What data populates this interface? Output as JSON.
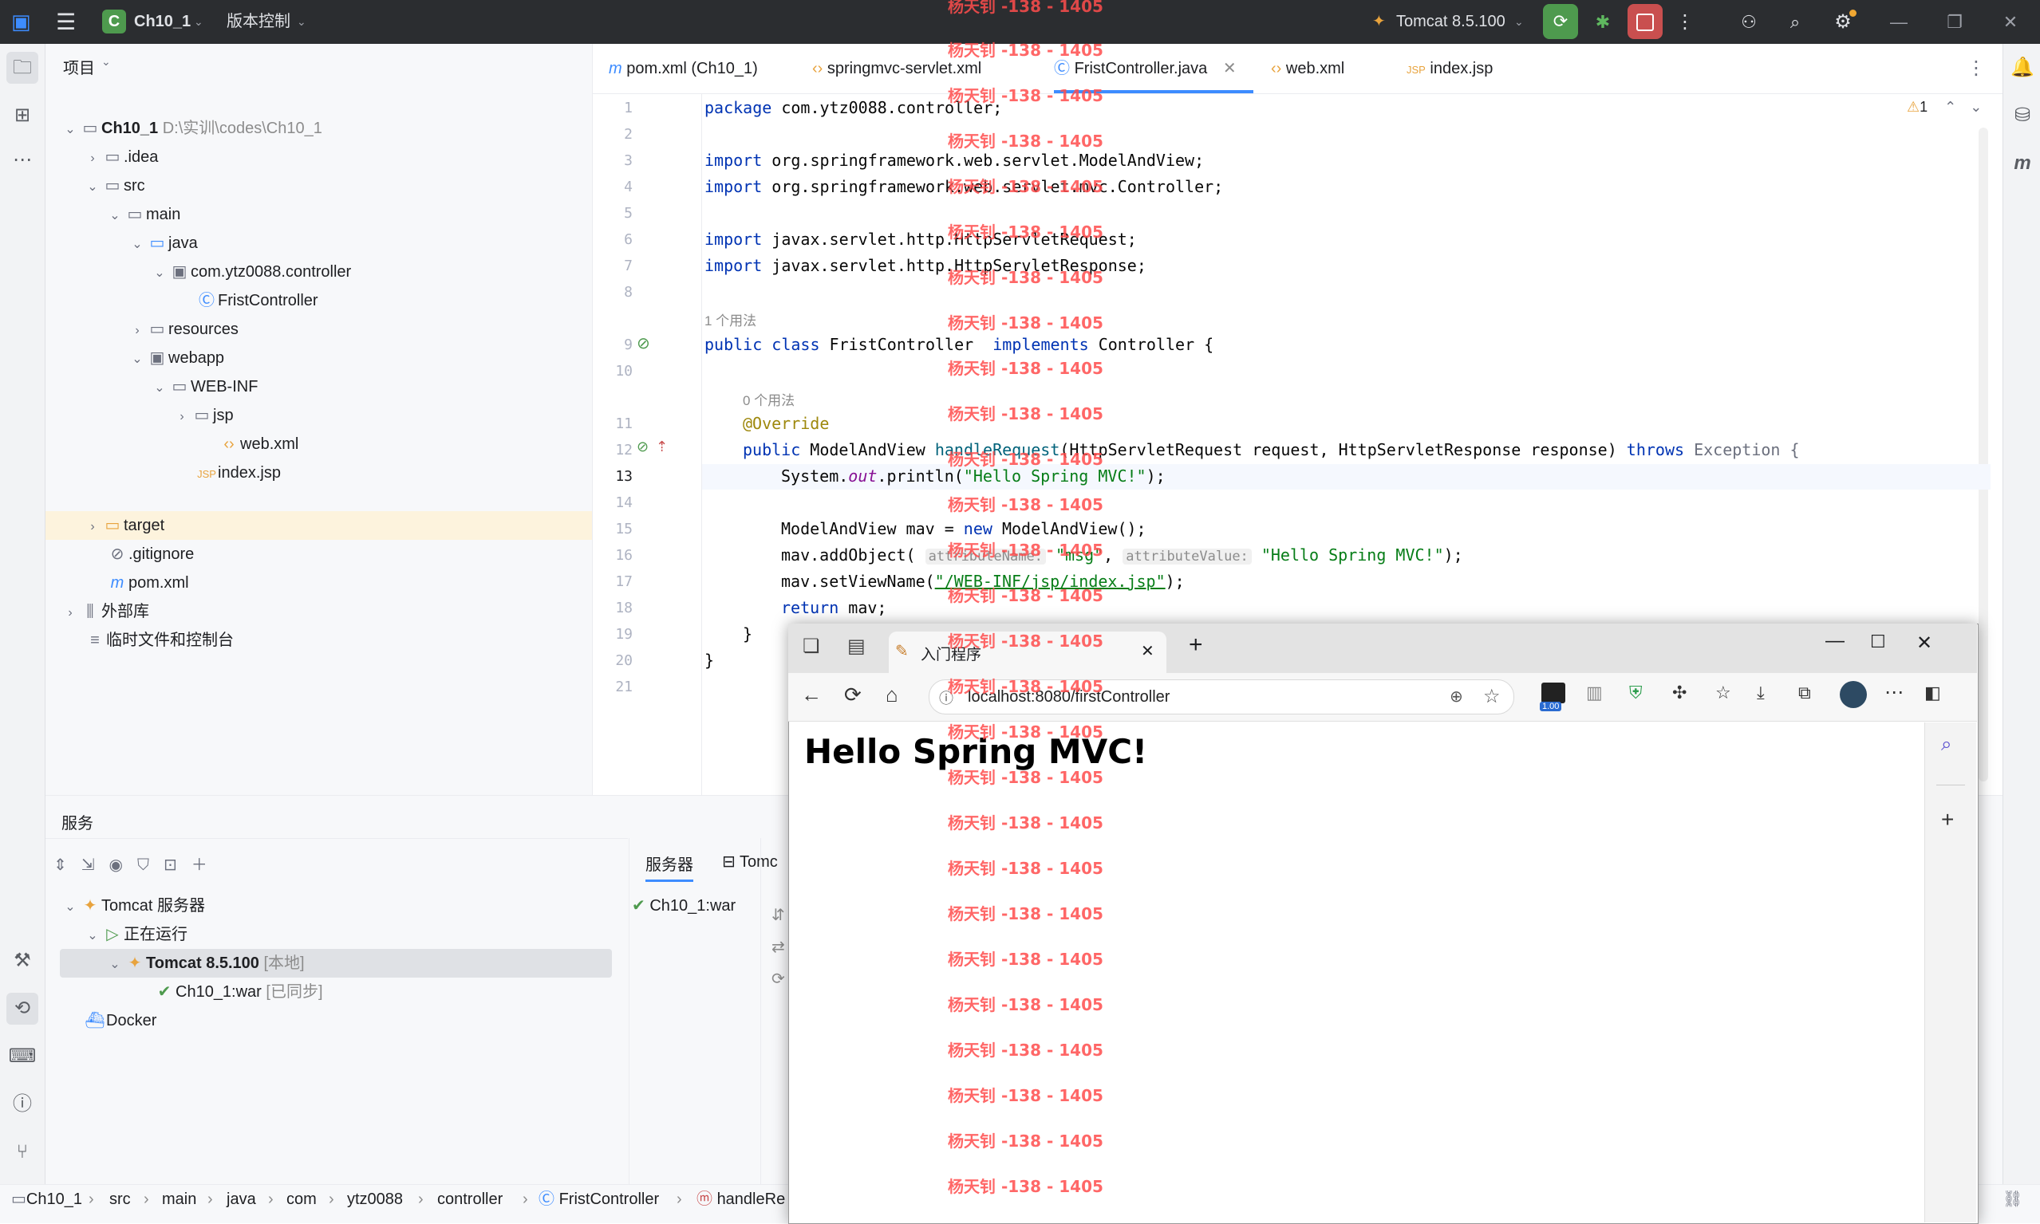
{
  "titlebar": {
    "project_badge": "C",
    "project_name": "Ch10_1",
    "vcs": "版本控制",
    "run_config": "Tomcat 8.5.100"
  },
  "project_panel": {
    "header": "项目",
    "tree": [
      {
        "label": "Ch10_1",
        "extra": "D:\\实训\\codes\\Ch10_1"
      },
      {
        "label": ".idea"
      },
      {
        "label": "src"
      },
      {
        "label": "main"
      },
      {
        "label": "java"
      },
      {
        "label": "com.ytz0088.controller"
      },
      {
        "label": "FristController"
      },
      {
        "label": "resources"
      },
      {
        "label": "webapp"
      },
      {
        "label": "WEB-INF"
      },
      {
        "label": "jsp"
      },
      {
        "label": "web.xml"
      },
      {
        "label": "index.jsp"
      },
      {
        "label": "target"
      },
      {
        "label": ".gitignore"
      },
      {
        "label": "pom.xml"
      },
      {
        "label": "外部库"
      },
      {
        "label": "临时文件和控制台"
      }
    ]
  },
  "editor": {
    "tabs": [
      "pom.xml (Ch10_1)",
      "springmvc-servlet.xml",
      "FristController.java",
      "web.xml",
      "index.jsp"
    ],
    "warning_count": "1",
    "usage_1": "1 个用法",
    "usage_2": "0 个用法",
    "line_numbers": [
      "1",
      "2",
      "3",
      "4",
      "5",
      "6",
      "7",
      "8",
      "9",
      "10",
      "11",
      "12",
      "13",
      "14",
      "15",
      "16",
      "17",
      "18",
      "19",
      "20",
      "21"
    ],
    "code": {
      "l1_kw": "package",
      "l1": " com.ytz0088.controller;",
      "l3_kw": "import",
      "l3": " org.springframework.web.servlet.ModelAndView;",
      "l4_kw": "import",
      "l4": " org.springframework.web.servlet.mvc.Controller;",
      "l6_kw": "import",
      "l6": " javax.servlet.http.HttpServletRequest;",
      "l7_kw": "import",
      "l7": " javax.servlet.http.HttpServletResponse;",
      "l9_kw": "public class",
      "l9_name": " FristController  ",
      "l9_kw2": "implements",
      "l9_rest": " Controller {",
      "l11": "@Override",
      "l12_kw": "public",
      "l12_a": " ModelAndView ",
      "l12_m": "handleRequest",
      "l12_b": "(HttpServletRequest request, HttpServletResponse response) ",
      "l12_kw2": "throws",
      "l12_c": " Exception {",
      "l13_a": "System.",
      "l13_f": "out",
      "l13_b": ".println(",
      "l13_s": "\"Hello Spring MVC!\"",
      "l13_c": ");",
      "l15_a": "ModelAndView mav = ",
      "l15_kw": "new",
      "l15_b": " ModelAndView();",
      "l16_a": "mav.addObject( ",
      "l16_h1": "attributeName:",
      "l16_s1": " \"msg\"",
      "l16_b": ", ",
      "l16_h2": "attributeValue:",
      "l16_s2": " \"Hello Spring MVC!\"",
      "l16_c": ");",
      "l17_a": "mav.setViewName(",
      "l17_s": "\"/WEB-INF/jsp/index.jsp\"",
      "l17_c": ");",
      "l18_kw": "return",
      "l18": " mav;",
      "l19": "}",
      "l20": "}"
    }
  },
  "services": {
    "header": "服务",
    "tree": [
      {
        "label": "Tomcat 服务器"
      },
      {
        "label": "正在运行"
      },
      {
        "label": "Tomcat 8.5.100",
        "extra": "[本地]"
      },
      {
        "label": "Ch10_1:war",
        "extra": "[已同步]"
      },
      {
        "label": "Docker"
      }
    ],
    "tab_server": "服务器",
    "tab_tomcat": "Tomc",
    "deploy_item": "Ch10_1:war"
  },
  "breadcrumb": [
    "Ch10_1",
    "src",
    "main",
    "java",
    "com",
    "ytz0088",
    "controller",
    "FristController",
    "handleRe"
  ],
  "browser": {
    "tab_title": "入门程序",
    "url": "localhost:8080/firstController",
    "ext_badge": "1.00",
    "heading": "Hello Spring MVC!"
  },
  "watermark": "杨天钊 -138 - 1405"
}
